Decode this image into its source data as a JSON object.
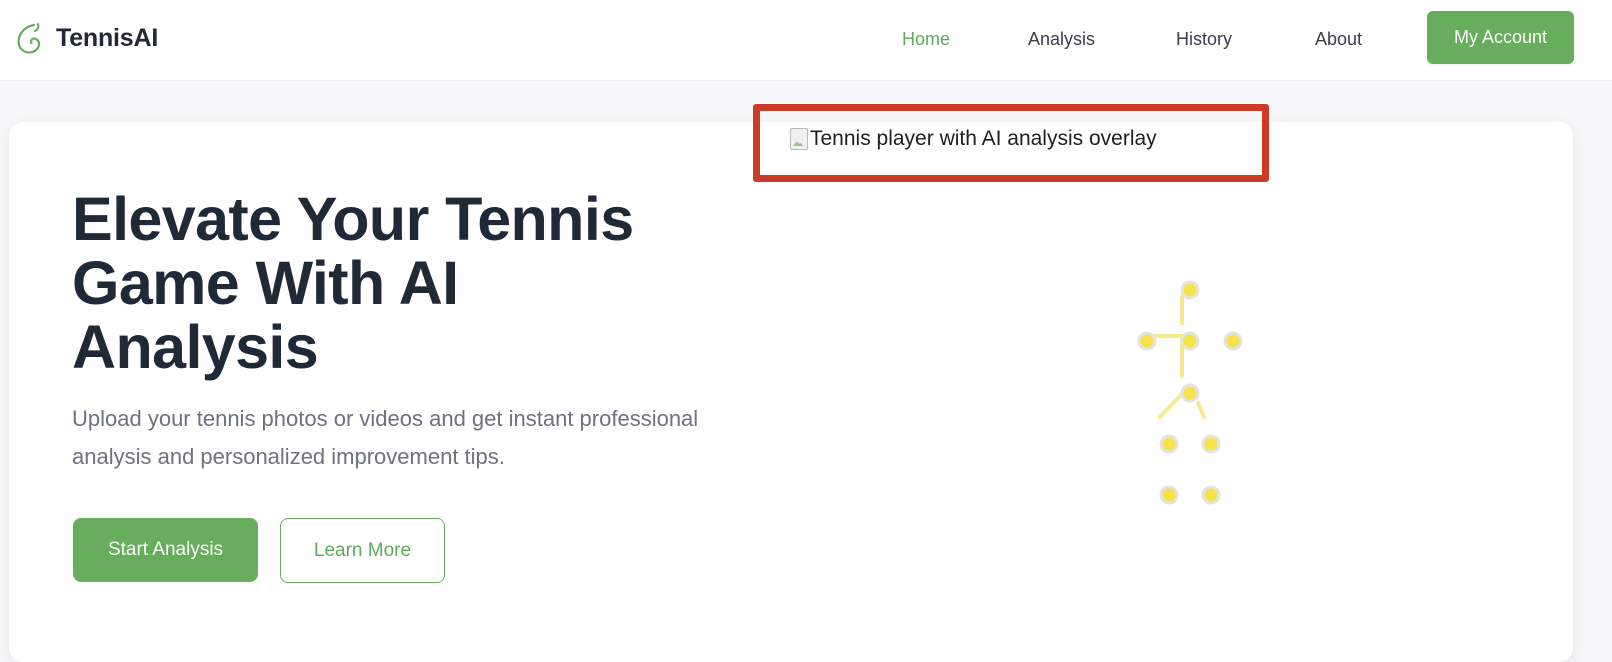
{
  "header": {
    "brand": "TennisAI",
    "nav": [
      {
        "label": "Home",
        "active": true
      },
      {
        "label": "Analysis",
        "active": false
      },
      {
        "label": "History",
        "active": false
      },
      {
        "label": "About",
        "active": false
      }
    ],
    "account_button": "My Account",
    "logo_icon": "tennis-ball-swirl-icon"
  },
  "hero": {
    "title": "Elevate Your Tennis Game With AI Analysis",
    "subtitle": "Upload your tennis photos or videos and get instant professional analysis and personalized improvement tips.",
    "primary_button": "Start Analysis",
    "secondary_button": "Learn More",
    "image_alt": "Tennis player with AI analysis overlay",
    "overlay": "pose-skeleton-keypoints"
  },
  "colors": {
    "accent": "#66ad5c",
    "text_dark": "#1f2937",
    "text_muted": "#6b7280",
    "highlight_box": "#cc3a28",
    "keypoint_fill": "#f6e24a",
    "skeleton_line": "#f8e98f"
  }
}
